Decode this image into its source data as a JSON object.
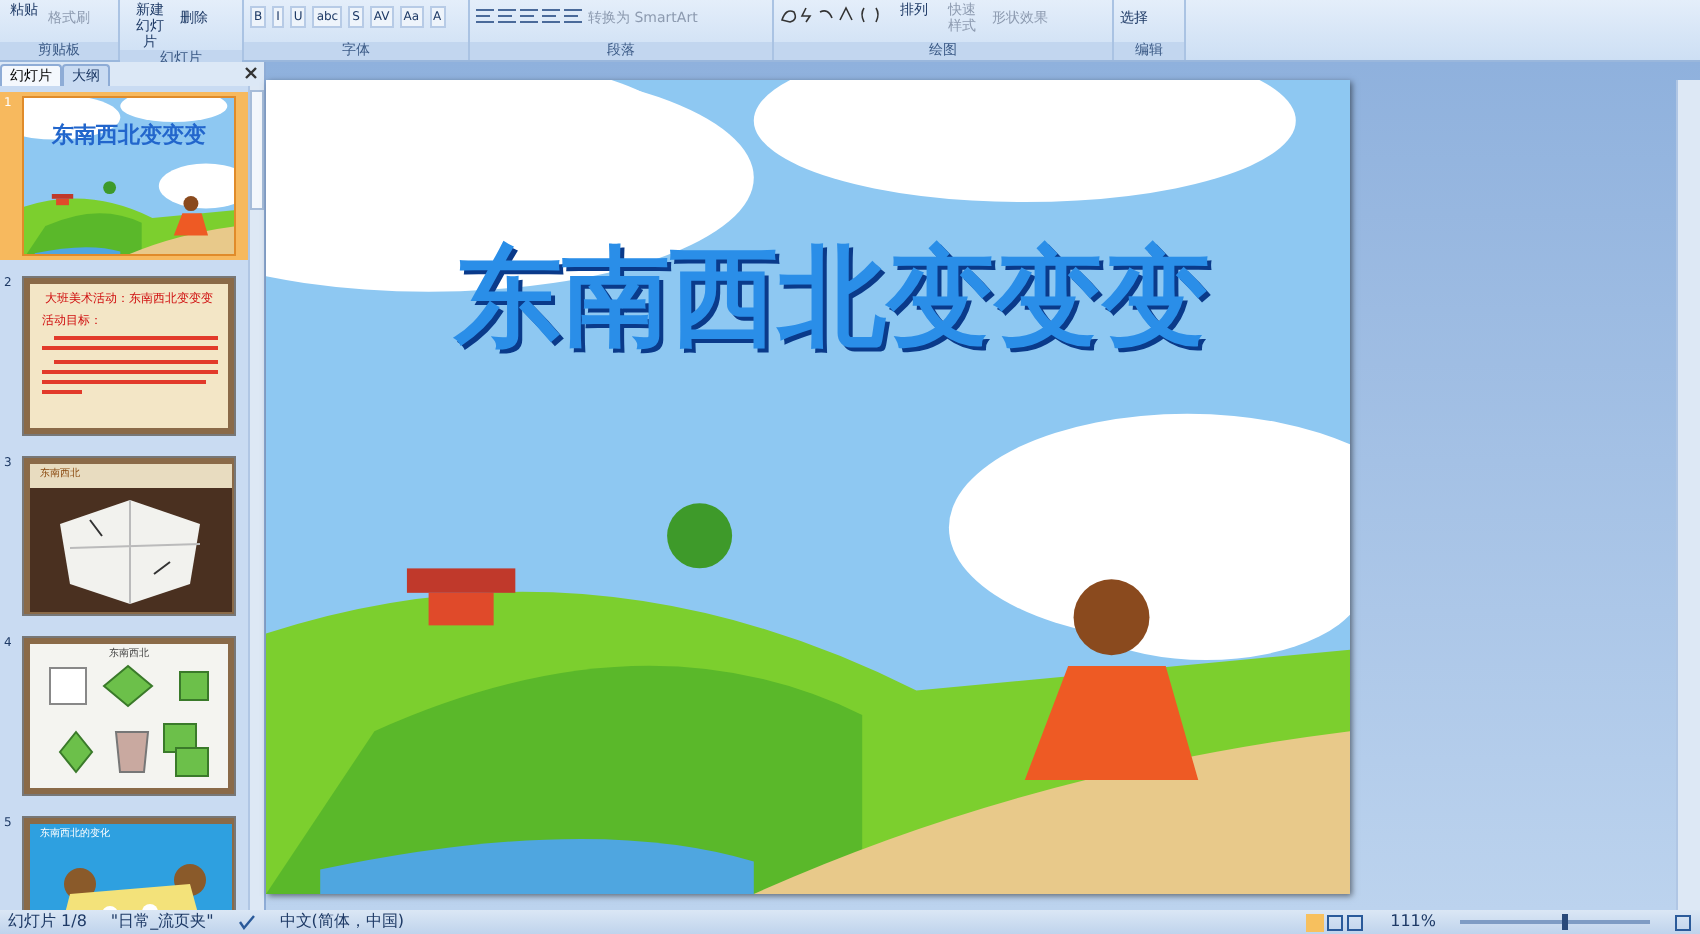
{
  "ribbon": {
    "groups": [
      {
        "label": "剪贴板",
        "items": [
          {
            "kind": "big",
            "label": "粘贴",
            "disabled": false
          },
          {
            "kind": "small",
            "label": "格式刷",
            "disabled": true
          }
        ]
      },
      {
        "label": "幻灯片",
        "items": [
          {
            "kind": "big",
            "label": "新建幻灯片",
            "disabled": false
          },
          {
            "kind": "small",
            "label": "删除",
            "disabled": false
          }
        ]
      },
      {
        "label": "字体",
        "items": [
          {
            "kind": "fmt",
            "label": "B",
            "disabled": false
          },
          {
            "kind": "fmt",
            "label": "I",
            "disabled": false
          },
          {
            "kind": "fmt",
            "label": "U",
            "disabled": false
          },
          {
            "kind": "fmt",
            "label": "abc",
            "disabled": false
          },
          {
            "kind": "fmt",
            "label": "S",
            "disabled": false
          },
          {
            "kind": "fmt",
            "label": "AV",
            "disabled": false
          },
          {
            "kind": "fmt",
            "label": "Aa",
            "disabled": false
          },
          {
            "kind": "fmt",
            "label": "A",
            "disabled": false
          }
        ]
      },
      {
        "label": "段落",
        "items": [
          {
            "kind": "align",
            "disabled": false
          },
          {
            "kind": "small",
            "label": "转换为 SmartArt",
            "disabled": true
          }
        ]
      },
      {
        "label": "绘图",
        "items": [
          {
            "kind": "shapes",
            "disabled": false
          },
          {
            "kind": "big",
            "label": "排列",
            "disabled": false
          },
          {
            "kind": "big",
            "label": "快速样式",
            "disabled": true
          },
          {
            "kind": "small",
            "label": "形状效果",
            "disabled": true
          }
        ]
      },
      {
        "label": "编辑",
        "items": [
          {
            "kind": "small",
            "label": "选择",
            "disabled": false
          }
        ]
      }
    ]
  },
  "panel": {
    "tabs": [
      {
        "label": "幻灯片",
        "selected": true
      },
      {
        "label": "大纲",
        "selected": false
      }
    ],
    "slides": [
      {
        "number": "1",
        "selected": true,
        "kind": "title",
        "title": "东南西北变变变"
      },
      {
        "number": "2",
        "selected": false,
        "kind": "text",
        "title": "大班美术活动：东南西北变变变",
        "subtitle": "活动目标："
      },
      {
        "number": "3",
        "selected": false,
        "title": "东南西北"
      },
      {
        "number": "4",
        "selected": false,
        "kind": "diagram",
        "title": "东南西北"
      },
      {
        "number": "5",
        "selected": false,
        "kind": "photo2",
        "title": "东南西北的变化"
      }
    ]
  },
  "slide": {
    "title": "东南西北变变变"
  },
  "status_bar": {
    "slide": "幻灯片 1/8",
    "theme": "\"日常_流页夹\"",
    "language": "中文(简体，中国)",
    "zoom": "111%",
    "zoom_slider": {
      "level": 0.55
    }
  }
}
